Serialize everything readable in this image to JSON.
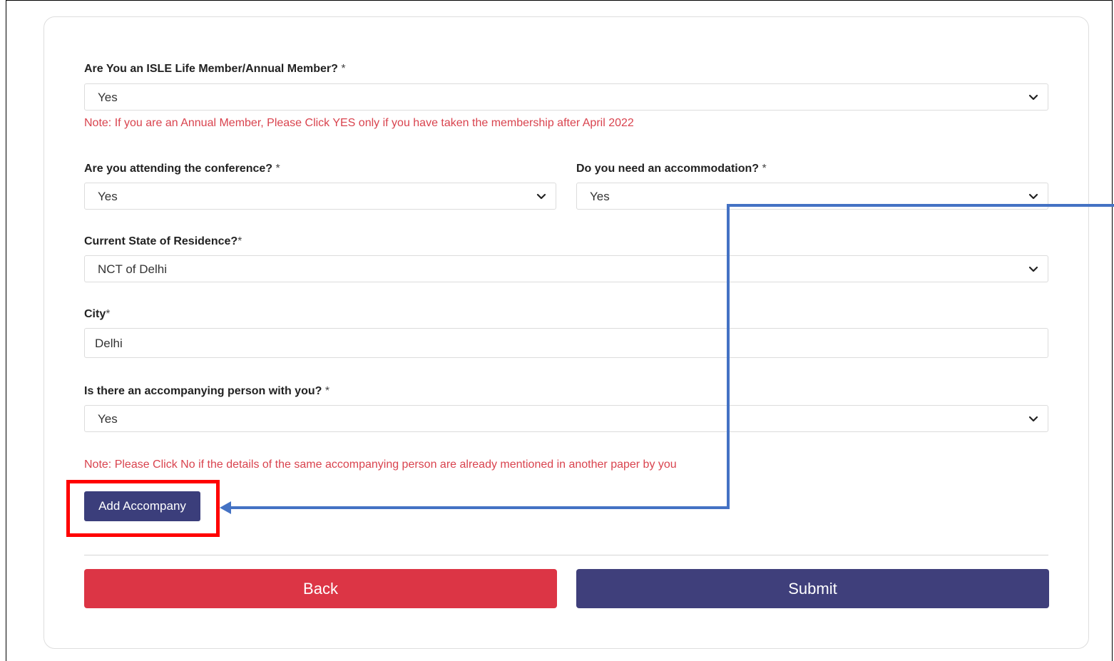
{
  "form": {
    "membership": {
      "label": "Are You an ISLE Life Member/Annual Member?",
      "req": "*",
      "value": "Yes",
      "note": "Note: If you are an Annual Member, Please Click YES only if you have taken the membership after April 2022"
    },
    "attending": {
      "label": "Are you attending the conference?",
      "req": "*",
      "value": "Yes"
    },
    "accommodation": {
      "label": "Do you need an accommodation?",
      "req": "*",
      "value": "Yes"
    },
    "state": {
      "label": "Current State of Residence?",
      "req": "*",
      "value": "NCT of Delhi"
    },
    "city": {
      "label": "City",
      "req": "*",
      "value": "Delhi"
    },
    "accompanying": {
      "label": "Is there an accompanying person with you?",
      "req": "*",
      "value": "Yes",
      "note": "Note: Please Click No if the details of the same accompanying person are already mentioned in another paper by you"
    },
    "add_accompany_label": "Add Accompany",
    "back_label": "Back",
    "submit_label": "Submit"
  },
  "colors": {
    "note": "#d9434e",
    "primary": "#3f3f7b",
    "danger": "#dc3545",
    "highlight": "#ff0000",
    "annotation_arrow": "#4472c4"
  },
  "icons": [
    "chevron-down-icon"
  ]
}
